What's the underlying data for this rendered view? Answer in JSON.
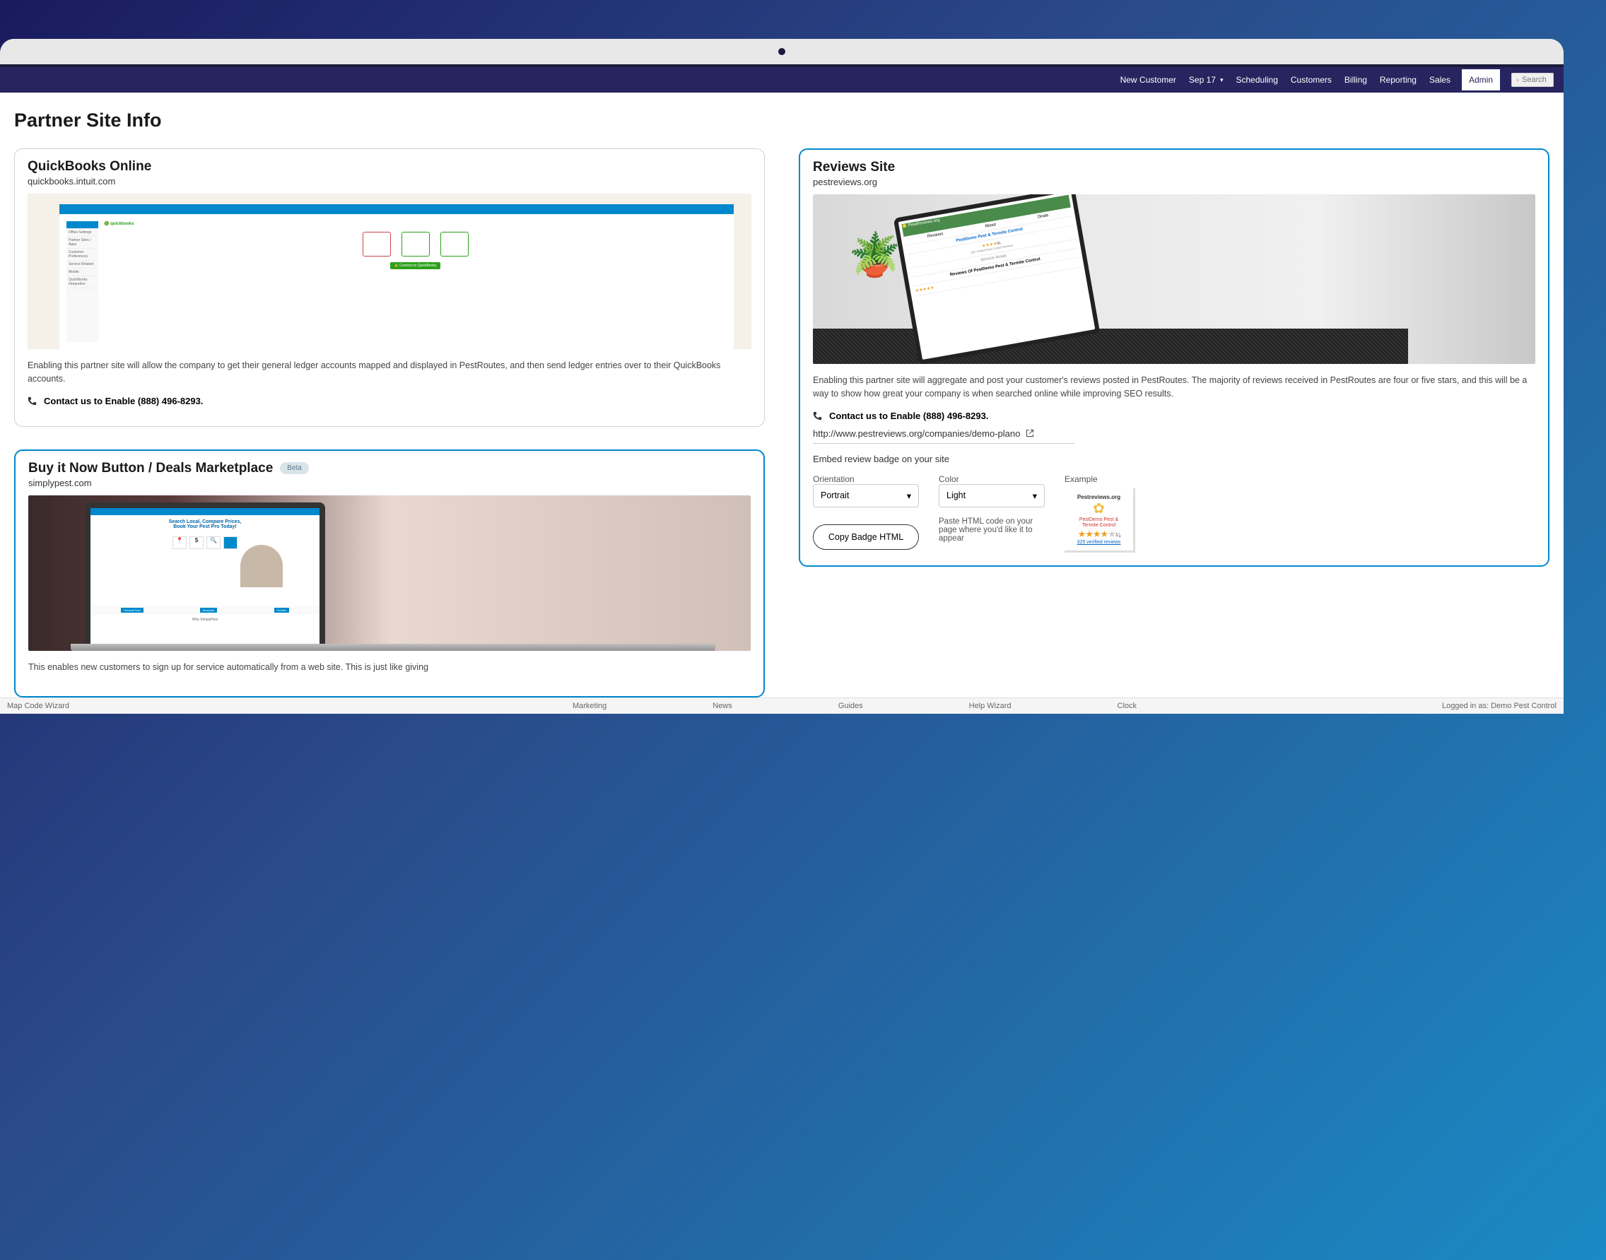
{
  "nav": {
    "newCustomer": "New Customer",
    "date": "Sep 17",
    "scheduling": "Scheduling",
    "customers": "Customers",
    "billing": "Billing",
    "reporting": "Reporting",
    "sales": "Sales",
    "admin": "Admin",
    "searchPlaceholder": "Search"
  },
  "pageTitle": "Partner Site Info",
  "qb": {
    "title": "QuickBooks Online",
    "sub": "quickbooks.intuit.com",
    "desc": "Enabling this partner site will allow the company to get their general ledger accounts mapped and displayed in PestRoutes, and then send ledger entries over to their QuickBooks accounts.",
    "contact": "Contact us to Enable (888) 496-8293."
  },
  "buyit": {
    "title": "Buy it Now Button / Deals Marketplace",
    "beta": "Beta",
    "sub": "simplypest.com",
    "desc": "This enables new customers to sign up for service automatically from a web site. This is just like giving"
  },
  "reviews": {
    "title": "Reviews Site",
    "sub": "pestreviews.org",
    "desc": "Enabling this partner site will aggregate and post your customer's reviews posted in PestRoutes. The majority of reviews received in PestRoutes are four or five stars, and this will be a way to show how great your company is when searched online while improving SEO results.",
    "contact": "Contact us to Enable (888) 496-8293.",
    "url": "http://www.pestreviews.org/companies/demo-plano",
    "embedLabel": "Embed review badge on your site",
    "orientationLabel": "Orientation",
    "orientationValue": "Portrait",
    "colorLabel": "Color",
    "colorValue": "Light",
    "exampleLabel": "Example",
    "copyBtn": "Copy Badge HTML",
    "pasteText": "Paste HTML code on your page where you'd like it to appear",
    "badge": {
      "site": "Pestreviews.org",
      "company": "PestDemo Pest & Termite Control",
      "frac": "¼",
      "verified": "325 verified reviews"
    }
  },
  "footer": {
    "mapCode": "Map Code Wizard",
    "marketing": "Marketing",
    "news": "News",
    "guides": "Guides",
    "helpWizard": "Help Wizard",
    "clock": "Clock",
    "loggedIn": "Logged in as: Demo Pest Control"
  }
}
